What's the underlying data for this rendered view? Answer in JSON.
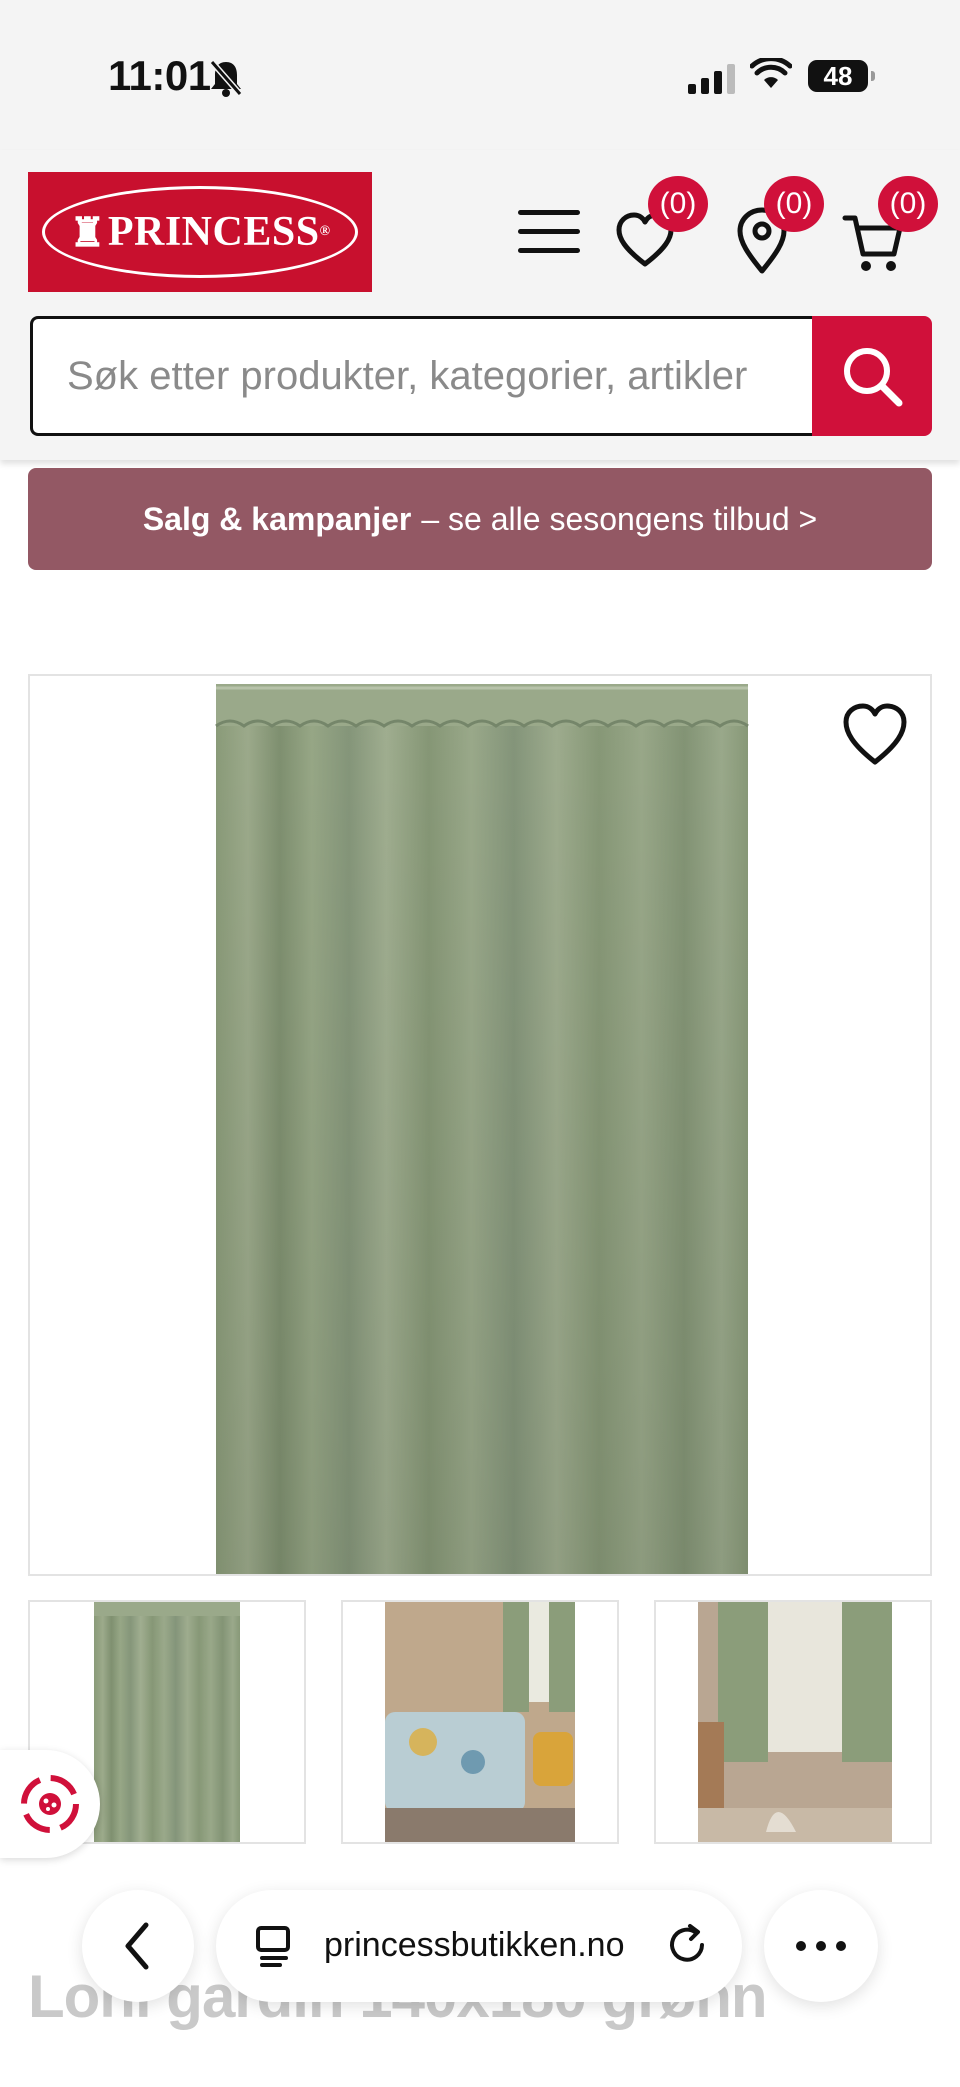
{
  "status_bar": {
    "time": "11:01",
    "battery": "48",
    "icons": [
      "bell-off-icon",
      "cellular-signal-icon",
      "wifi-icon",
      "battery-icon"
    ]
  },
  "header": {
    "logo_text": "PRINCESS",
    "logo_registered": "®",
    "brand_color": "#c8102e",
    "wishlist_count": "(0)",
    "stores_count": "(0)",
    "cart_count": "(0)",
    "icons": [
      "menu-icon",
      "heart-icon",
      "location-pin-icon",
      "cart-icon",
      "search-icon"
    ]
  },
  "search": {
    "placeholder": "Søk etter produkter, kategorier, artikler"
  },
  "promo": {
    "bold": "Salg & kampanjer",
    "rest": "– se alle sesongens tilbud >",
    "color": "#935864"
  },
  "product": {
    "title": "Lohi gardin 140x180 grønn",
    "curtain_color": "#8b9d7a"
  },
  "browser": {
    "url": "princessbutikken.no",
    "icons": [
      "chevron-left-icon",
      "page-icon",
      "reload-icon",
      "more-icon"
    ]
  }
}
